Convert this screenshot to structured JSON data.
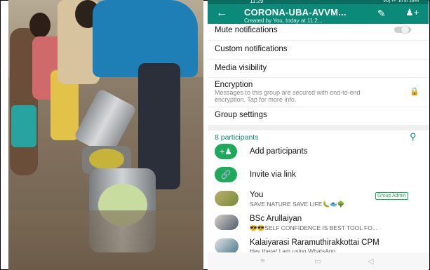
{
  "statusbar": {
    "time": "11:29",
    "icons": "Vo) ᵞᵃᵗ .ııl ıll 18%"
  },
  "header": {
    "back_icon": "arrow-left-icon",
    "title": "CORONA-UBA-AVVM...",
    "subtitle": "Created by You, today at 11:2...",
    "edit_icon": "pencil-icon",
    "add_icon": "add-participant-icon"
  },
  "settings": {
    "mute": "Mute notifications",
    "custom": "Custom notifications",
    "media": "Media visibility",
    "encryption": "Encryption",
    "encryption_desc": "Messages to this group are secured with end-to-end encryption. Tap for more info.",
    "group_settings": "Group settings"
  },
  "participants": {
    "count_label": "8 participants",
    "add_label": "Add participants",
    "invite_label": "Invite via link",
    "list": [
      {
        "name": "You",
        "status": "SAVE NATURE SAVE LIFE🐛🐟🌳",
        "badge": "Group Admin"
      },
      {
        "name": "BSc Arullaiyan",
        "status": "😎😎SELF CONFIDENCE IS BEST TOOL FO..."
      },
      {
        "name": "Kalaiyarasi Raramuthirakkottai CPM",
        "status": "Hey there! I am using WhatsApp."
      }
    ]
  },
  "navbar": {
    "menu": "≡",
    "home": "▭",
    "back": "◁"
  },
  "colors": {
    "primary": "#0b8a79",
    "accent": "#1faa59"
  }
}
